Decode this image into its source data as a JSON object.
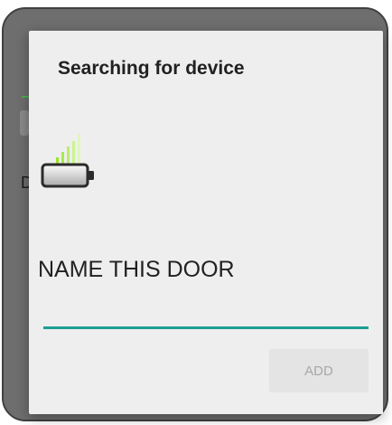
{
  "background": {
    "partial_letter": "D"
  },
  "dialog": {
    "title": "Searching for device",
    "device_icon": "battery-signal-icon",
    "name_label": "NAME THIS DOOR",
    "name_input": {
      "value": "",
      "placeholder": ""
    },
    "add_button_label": "ADD"
  },
  "colors": {
    "accent_teal": "#1e9e94",
    "signal_green": "#9be52e",
    "frame": "#404040",
    "dialog_bg": "#eeeeee",
    "disabled_text": "#a8a8a8"
  }
}
